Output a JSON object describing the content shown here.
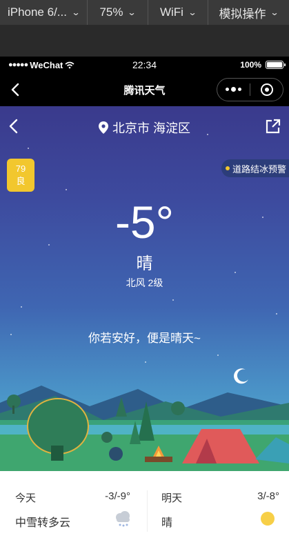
{
  "devtools": {
    "device": "iPhone 6/...",
    "zoom": "75%",
    "network": "WiFi",
    "action": "模拟操作"
  },
  "status_bar": {
    "carrier": "WeChat",
    "time": "22:34",
    "battery": "100%"
  },
  "wechat_nav": {
    "title": "腾讯天气"
  },
  "weather": {
    "location": "北京市 海淀区",
    "aqi_value": "79",
    "aqi_level": "良",
    "alert": "道路结冰预警",
    "temperature": "-5°",
    "condition": "晴",
    "wind": "北风 2级",
    "greeting": "你若安好，便是晴天~"
  },
  "forecast": {
    "today": {
      "label": "今天",
      "range": "-3/-9°",
      "desc": "中雪转多云",
      "icon": "snow-cloud-icon"
    },
    "tomorrow": {
      "label": "明天",
      "range": "3/-8°",
      "desc": "晴",
      "icon": "sun-icon"
    }
  },
  "colors": {
    "aqi_good": "#f2c72e",
    "sun": "#f7cf47",
    "sky_top": "#3a3a8c",
    "sky_bottom": "#58b7cf"
  }
}
